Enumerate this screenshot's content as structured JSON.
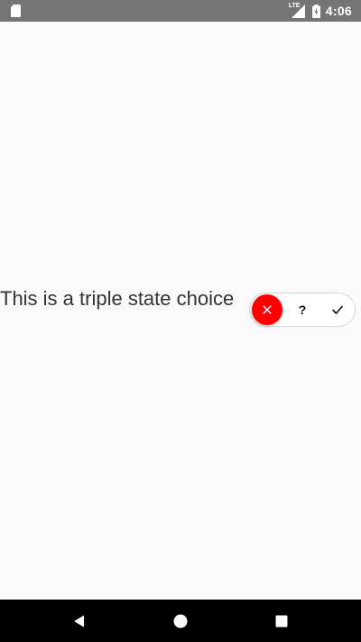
{
  "status_bar": {
    "network_label": "LTE",
    "time": "4:06",
    "icons": [
      "sd-card-icon",
      "lte-signal-icon",
      "battery-charging-icon"
    ]
  },
  "main": {
    "label": "This is a triple state choice",
    "triple_state": {
      "options": [
        {
          "id": "no",
          "symbol": "✕",
          "icon": "close-icon"
        },
        {
          "id": "unknown",
          "symbol": "?",
          "icon": "question-icon"
        },
        {
          "id": "yes",
          "symbol": "✓",
          "icon": "check-icon"
        }
      ],
      "selected": "no",
      "selected_color": "#fe0000"
    }
  },
  "nav_bar": {
    "icons": [
      "back-icon",
      "home-icon",
      "recents-icon"
    ]
  },
  "colors": {
    "status_bar": "#757575",
    "background": "#fafafa",
    "nav_bar": "#000000",
    "text": "#333333",
    "accent_red": "#fe0000"
  }
}
